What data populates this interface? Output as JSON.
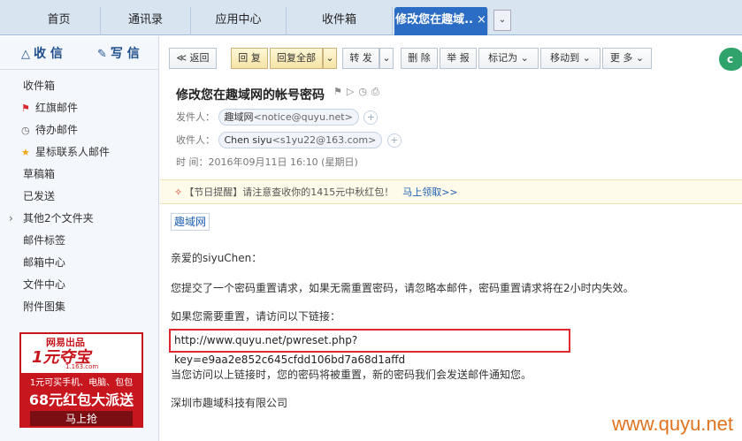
{
  "tabs": [
    {
      "label": "首页"
    },
    {
      "label": "通讯录"
    },
    {
      "label": "应用中心"
    },
    {
      "label": "收件箱"
    },
    {
      "label": "修改您在趣域..",
      "close": "×"
    }
  ],
  "tab_dropdown": "⌄",
  "sidebar": {
    "receive_label": "收 信",
    "write_label": "写 信",
    "items": [
      {
        "label": "收件箱"
      },
      {
        "label": "红旗邮件"
      },
      {
        "label": "待办邮件"
      },
      {
        "label": "星标联系人邮件"
      },
      {
        "label": "草稿箱"
      },
      {
        "label": "已发送"
      },
      {
        "label": "其他2个文件夹"
      },
      {
        "label": "邮件标签"
      },
      {
        "label": "邮箱中心"
      },
      {
        "label": "文件中心"
      },
      {
        "label": "附件图集"
      }
    ]
  },
  "ad": {
    "brand": "网易出品",
    "logo": "1元夺宝",
    "url": "1.163.com",
    "line1": "1元可买手机、电脑、包包",
    "line2": "68元红包大派送",
    "button": "马上抢"
  },
  "toolbar": {
    "back": "≪ 返回",
    "reply": "回 复",
    "reply_all": "回复全部",
    "forward": "转 发",
    "delete": "删 除",
    "report": "举 报",
    "mark_as": "标记为",
    "move_to": "移动到",
    "more": "更 多",
    "caret": "⌄"
  },
  "email": {
    "subject": "修改您在趣域网的帐号密码",
    "from_label": "发件人：",
    "from_name": "趣域网",
    "from_addr": "<notice@quyu.net>",
    "to_label": "收件人：",
    "to_name": "Chen siyu",
    "to_addr": "<s1yu22@163.com>",
    "time_label": "时  间：",
    "time": "2016年09月11日 16:10 (星期日)",
    "plus": "+"
  },
  "notice": {
    "text": "【节日提醒】请注意查收你的1415元中秋红包！",
    "link": "马上领取>>"
  },
  "body": {
    "brand": "趣域网",
    "greeting": "亲爱的siyuChen：",
    "para1": "您提交了一个密码重置请求，如果无需重置密码，请忽略本邮件，密码重置请求将在2小时内失效。",
    "para2": "如果您需要重置，请访问以下链接：",
    "link": "http://www.quyu.net/pwreset.php?key=e9aa2e852c645cfdd106bd7a68d1affd",
    "para3": "当您访问以上链接时，您的密码将被重置，新的密码我们会发送邮件通知您。",
    "signature": "深圳市趣域科技有限公司"
  },
  "watermark": "www.quyu.net"
}
